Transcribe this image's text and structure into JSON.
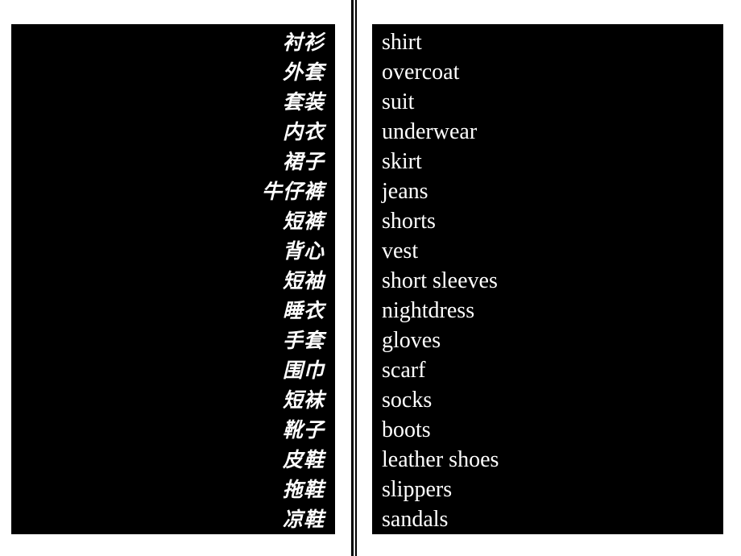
{
  "page": {
    "background_color": "#ffffff",
    "panel_color": "#000000",
    "text_color": "#ffffff",
    "divider_color": "#000000"
  },
  "columns": {
    "source": {
      "name": "chinese-vocabulary-column",
      "language": "Chinese",
      "alignment": "right"
    },
    "target": {
      "name": "english-vocabulary-column",
      "language": "English",
      "alignment": "left"
    }
  },
  "vocabulary": [
    {
      "source": "衬衫",
      "target": "shirt"
    },
    {
      "source": "外套",
      "target": "overcoat"
    },
    {
      "source": "套装",
      "target": "suit"
    },
    {
      "source": "内衣",
      "target": "underwear"
    },
    {
      "source": "裙子",
      "target": "skirt"
    },
    {
      "source": "牛仔裤",
      "target": "jeans"
    },
    {
      "source": "短裤",
      "target": "shorts"
    },
    {
      "source": "背心",
      "target": "vest"
    },
    {
      "source": "短袖",
      "target": "short sleeves"
    },
    {
      "source": "睡衣",
      "target": "nightdress"
    },
    {
      "source": "手套",
      "target": "gloves"
    },
    {
      "source": "围巾",
      "target": "scarf"
    },
    {
      "source": "短袜",
      "target": "socks"
    },
    {
      "source": "靴子",
      "target": "boots"
    },
    {
      "source": "皮鞋",
      "target": "leather shoes"
    },
    {
      "source": "拖鞋",
      "target": "slippers"
    },
    {
      "source": "凉鞋",
      "target": "sandals"
    }
  ]
}
